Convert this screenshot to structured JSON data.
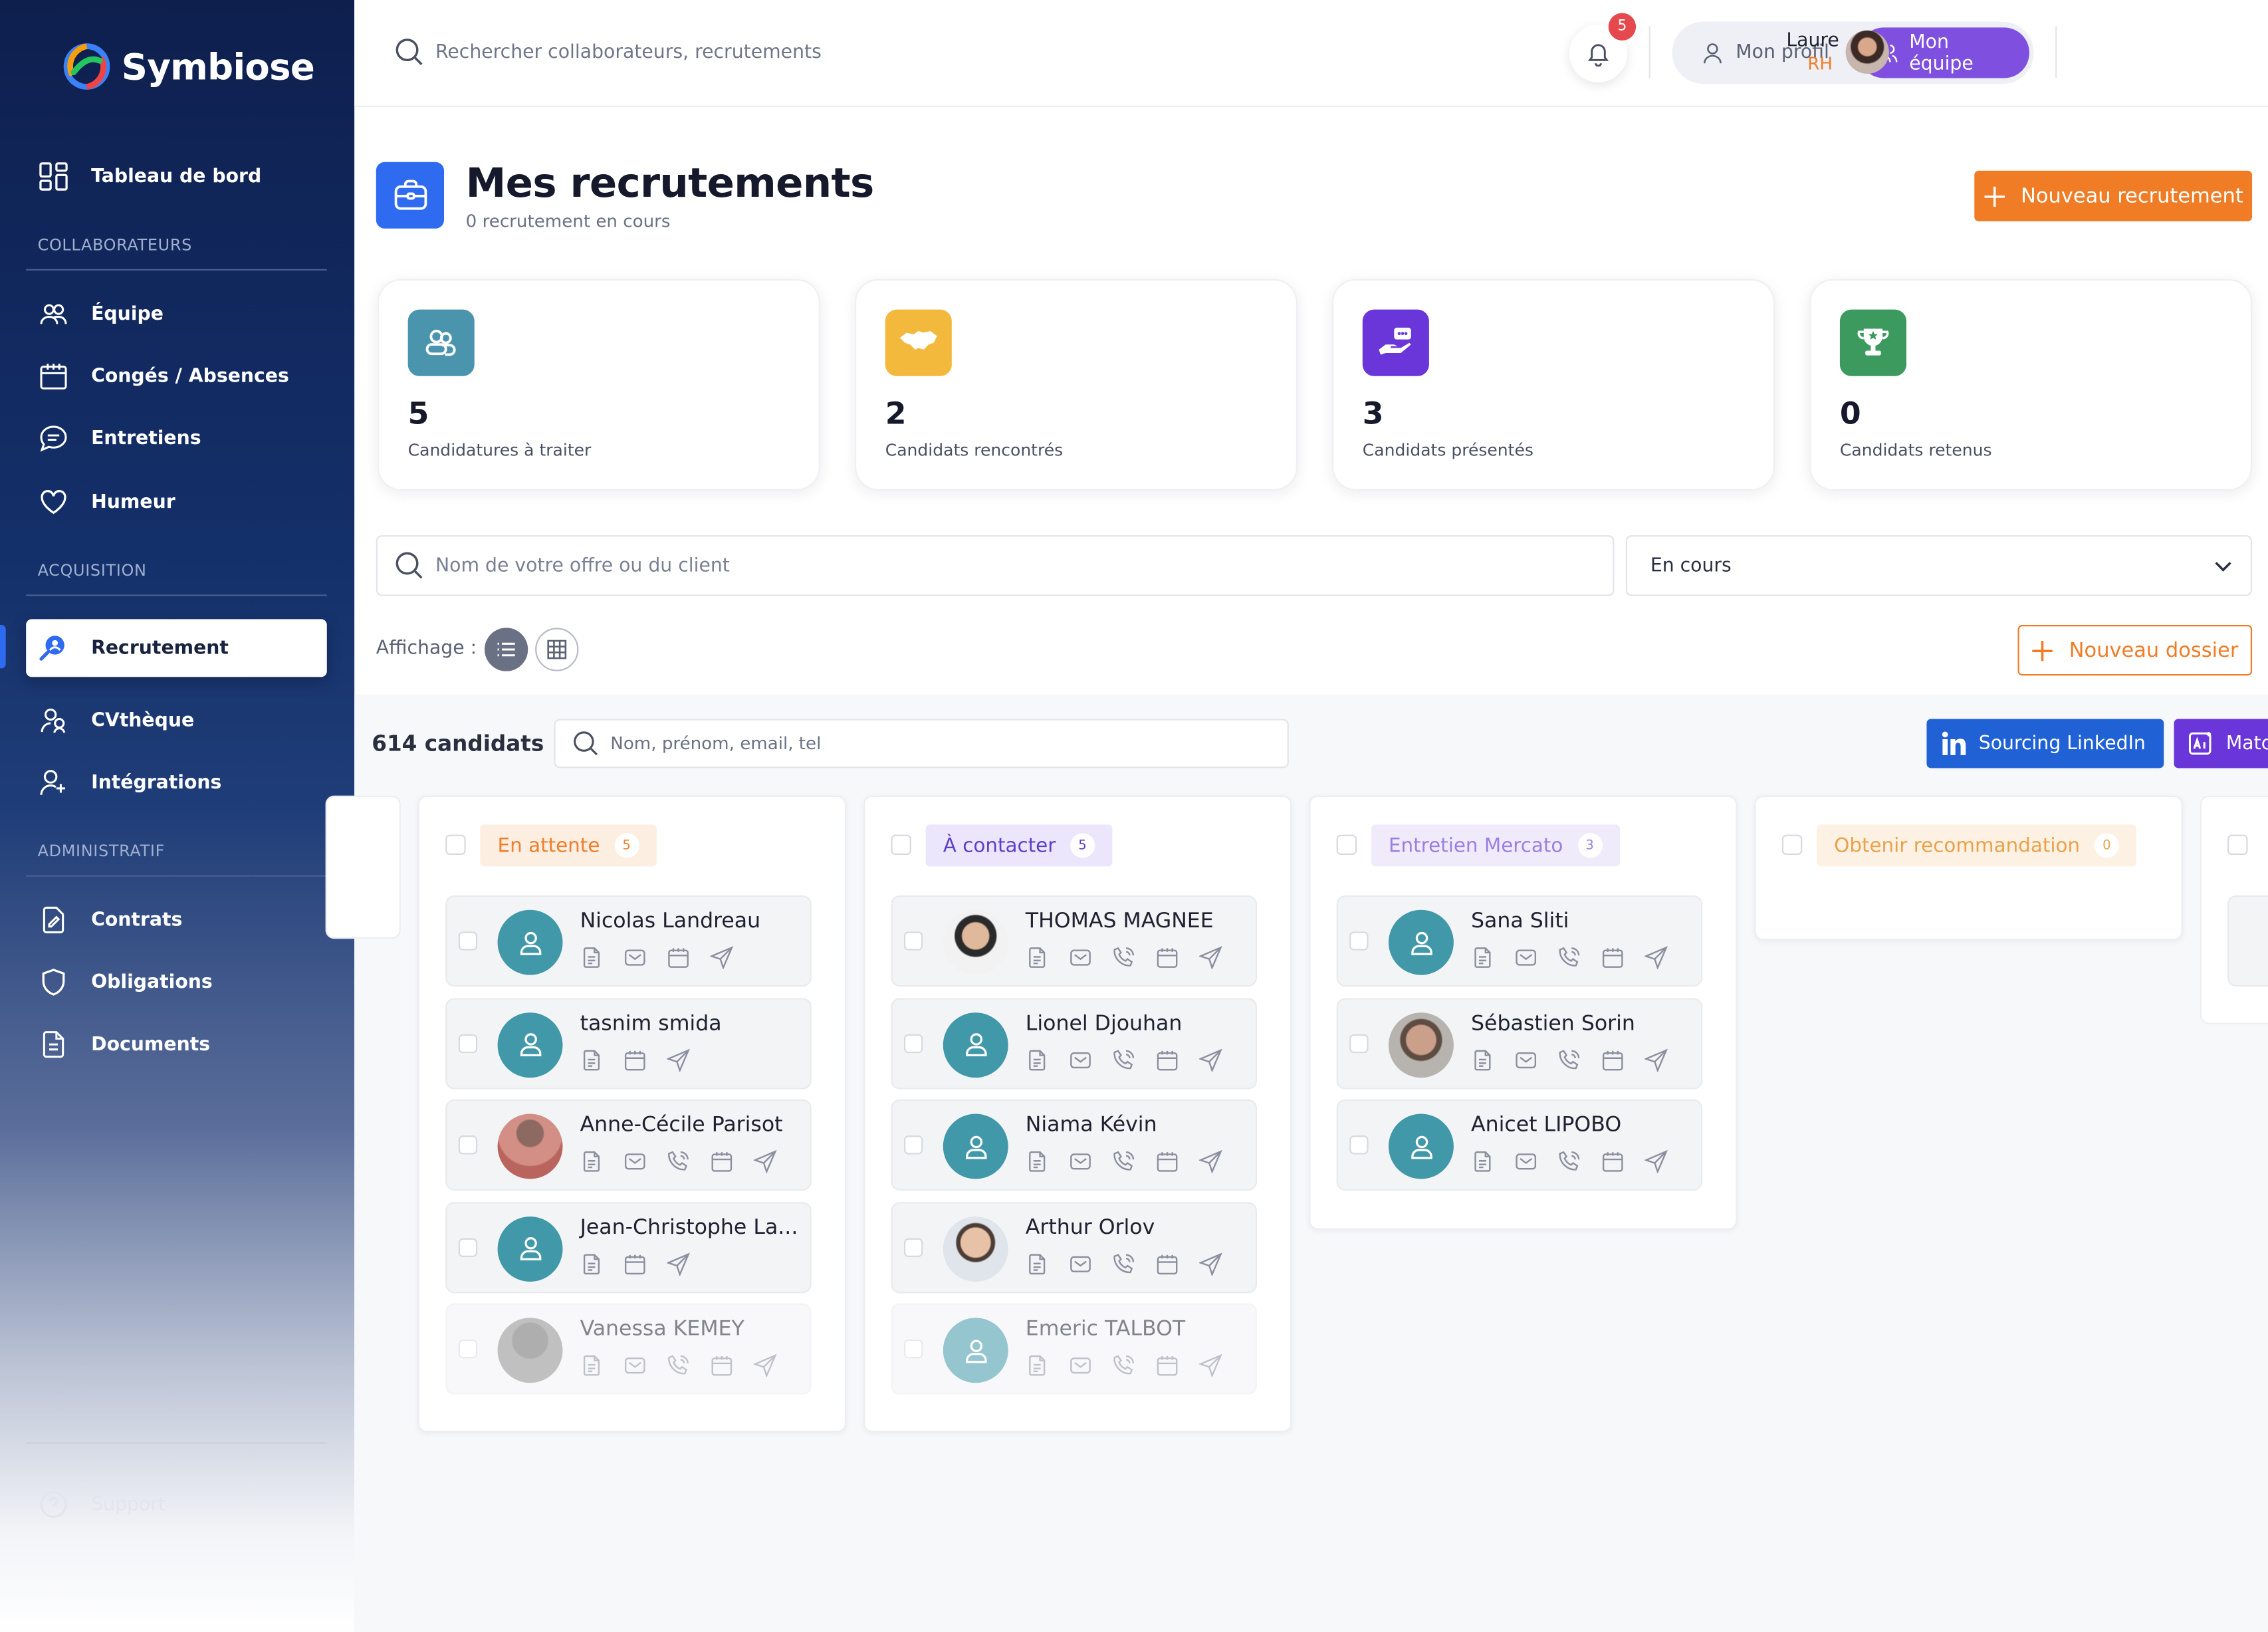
{
  "app": {
    "name": "Symbiose"
  },
  "sidebar": {
    "dashboard": "Tableau de bord",
    "sections": {
      "collaborateurs": "COLLABORATEURS",
      "acquisition": "ACQUISITION",
      "administratif": "ADMINISTRATIF"
    },
    "items": {
      "equipe": "Équipe",
      "conges": "Congés / Absences",
      "entretiens": "Entretiens",
      "humeur": "Humeur",
      "recrutement": "Recrutement",
      "cvtheque": "CVthèque",
      "integrations": "Intégrations",
      "contrats": "Contrats",
      "obligations": "Obligations",
      "documents": "Documents",
      "support": "Support"
    }
  },
  "topbar": {
    "search_placeholder": "Rechercher collaborateurs, recrutements",
    "notifications": "5",
    "profile_btn": "Mon profil",
    "team_btn": "Mon équipe",
    "user_name": "Laure",
    "user_role": "RH"
  },
  "header": {
    "title": "Mes recrutements",
    "subtitle": "0 recrutement en cours",
    "new_recruitment": "Nouveau recrutement"
  },
  "stats": [
    {
      "value": "5",
      "label": "Candidatures à traiter",
      "color": "#4a95ad",
      "icon": "people-icon"
    },
    {
      "value": "2",
      "label": "Candidats rencontrés",
      "color": "#f3b93c",
      "icon": "handshake-icon"
    },
    {
      "value": "3",
      "label": "Candidats présentés",
      "color": "#6a36d9",
      "icon": "hand-chat-icon"
    },
    {
      "value": "0",
      "label": "Candidats retenus",
      "color": "#3c9a5f",
      "icon": "trophy-icon"
    }
  ],
  "filters": {
    "offer_placeholder": "Nom de votre offre ou du client",
    "status_value": "En cours",
    "display_label": "Affichage :",
    "new_folder": "Nouveau dossier"
  },
  "candidates": {
    "count": "614 candidats",
    "search_placeholder": "Nom, prénom, email, tel",
    "linkedin_btn": "Sourcing LinkedIn",
    "match_btn": "Matc"
  },
  "columns": [
    {
      "title": "En attente",
      "count": "5",
      "bg": "#fdeee2",
      "fg": "#ef7f2c",
      "cards": [
        {
          "name": "Nicolas Landreau",
          "avatar": "default"
        },
        {
          "name": "tasnim smida",
          "avatar": "default"
        },
        {
          "name": "Anne-Cécile Parisot",
          "avatar": "photo"
        },
        {
          "name": "Jean-Christophe La...",
          "avatar": "default"
        },
        {
          "name": "Vanessa KEMEY",
          "avatar": "photo"
        }
      ]
    },
    {
      "title": "À contacter",
      "count": "5",
      "bg": "#ebe6fb",
      "fg": "#5d3fc7",
      "cards": [
        {
          "name": "THOMAS MAGNEE",
          "avatar": "photo"
        },
        {
          "name": "Lionel Djouhan",
          "avatar": "default"
        },
        {
          "name": "Niama Kévin",
          "avatar": "default"
        },
        {
          "name": "Arthur Orlov",
          "avatar": "photo"
        },
        {
          "name": "Emeric TALBOT",
          "avatar": "default"
        }
      ]
    },
    {
      "title": "Entretien Mercato",
      "count": "3",
      "bg": "#efebfb",
      "fg": "#9b7fe0",
      "cards": [
        {
          "name": "Sana Sliti",
          "avatar": "default"
        },
        {
          "name": "Sébastien Sorin",
          "avatar": "photo"
        },
        {
          "name": "Anicet LIPOBO",
          "avatar": "default"
        }
      ]
    },
    {
      "title": "Obtenir recommandation",
      "count": "0",
      "bg": "#fdf1e4",
      "fg": "#e9a24a",
      "cards": []
    }
  ]
}
